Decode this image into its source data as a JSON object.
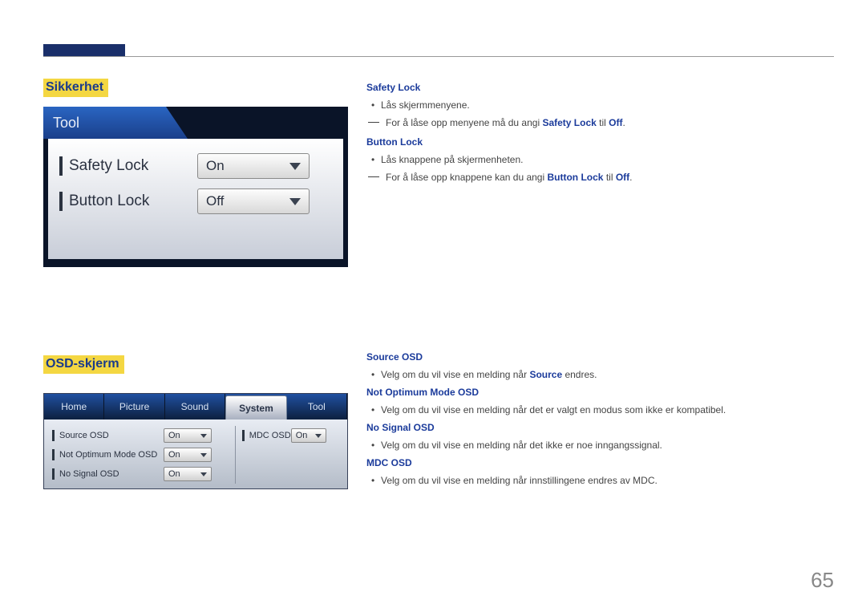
{
  "page_number": "65",
  "sections": {
    "sikkerhet": {
      "heading": "Sikkerhet",
      "tool_panel": {
        "tab_label": "Tool",
        "rows": [
          {
            "label": "Safety Lock",
            "value": "On"
          },
          {
            "label": "Button Lock",
            "value": "Off"
          }
        ]
      },
      "desc": {
        "safety_lock": {
          "title": "Safety Lock",
          "bullet": "Lås skjermmenyene.",
          "note_pre": "For å låse opp menyene må du angi ",
          "note_b1": "Safety Lock",
          "note_mid": " til ",
          "note_b2": "Off",
          "note_end": "."
        },
        "button_lock": {
          "title": "Button Lock",
          "bullet": "Lås knappene på skjermenheten.",
          "note_pre": "For å låse opp knappene kan du angi ",
          "note_b1": "Button Lock",
          "note_mid": " til ",
          "note_b2": "Off",
          "note_end": "."
        }
      }
    },
    "osd": {
      "heading": "OSD-skjerm",
      "panel": {
        "tabs": [
          "Home",
          "Picture",
          "Sound",
          "System",
          "Tool"
        ],
        "active_tab": "System",
        "left_rows": [
          {
            "label": "Source OSD",
            "value": "On"
          },
          {
            "label": "Not Optimum Mode OSD",
            "value": "On"
          },
          {
            "label": "No Signal OSD",
            "value": "On"
          }
        ],
        "right_rows": [
          {
            "label": "MDC OSD",
            "value": "On"
          }
        ]
      },
      "desc": {
        "source_osd": {
          "title": "Source OSD",
          "bullet_pre": "Velg om du vil vise en melding når ",
          "bullet_b": "Source",
          "bullet_post": " endres."
        },
        "not_optimum": {
          "title": "Not Optimum Mode OSD",
          "bullet": "Velg om du vil vise en melding når det er valgt en modus som ikke er kompatibel."
        },
        "no_signal": {
          "title": "No Signal OSD",
          "bullet": "Velg om du vil vise en melding når det ikke er noe inngangssignal."
        },
        "mdc": {
          "title": "MDC OSD",
          "bullet": "Velg om du vil vise en melding når innstillingene endres av MDC."
        }
      }
    }
  }
}
